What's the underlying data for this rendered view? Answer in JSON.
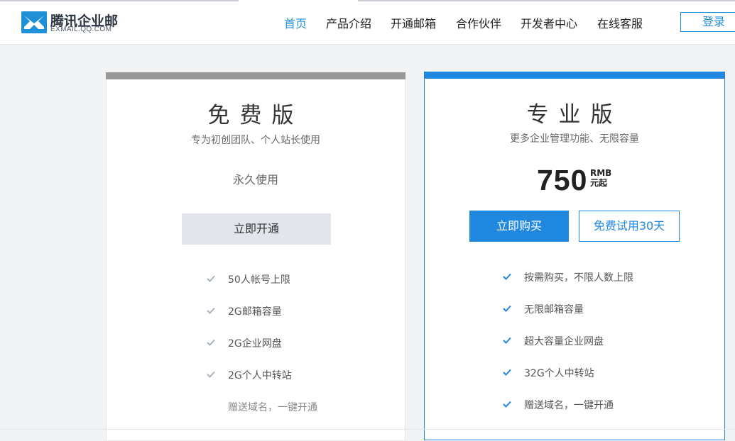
{
  "header": {
    "logo_text": "腾讯企业邮",
    "logo_sub": "EXMAIL.QQ.COM",
    "nav": [
      "首页",
      "产品介绍",
      "开通邮箱",
      "合作伙伴",
      "开发者中心",
      "在线客服"
    ],
    "login_label": "登录"
  },
  "free_plan": {
    "title": "免费版",
    "desc": "专为初创团队、个人站长使用",
    "duration": "永久使用",
    "button": "立即开通",
    "features": [
      "50人帐号上限",
      "2G邮箱容量",
      "2G企业网盘",
      "2G个人中转站",
      "赠送域名，一键开通"
    ]
  },
  "pro_plan": {
    "title": "专业版",
    "desc": "更多企业管理功能、无限容量",
    "price": "750",
    "currency": "RMB",
    "price_suffix": "元起",
    "buy_button": "立即购买",
    "trial_button": "免费试用30天",
    "features": [
      "按需购买，不限人数上限",
      "无限邮箱容量",
      "超大容量企业网盘",
      "32G个人中转站",
      "赠送域名，一键开通"
    ]
  },
  "colors": {
    "accent": "#2188e0",
    "free_bar": "#999999",
    "check_free": "#a9b3bd",
    "check_pro": "#2188e0"
  }
}
